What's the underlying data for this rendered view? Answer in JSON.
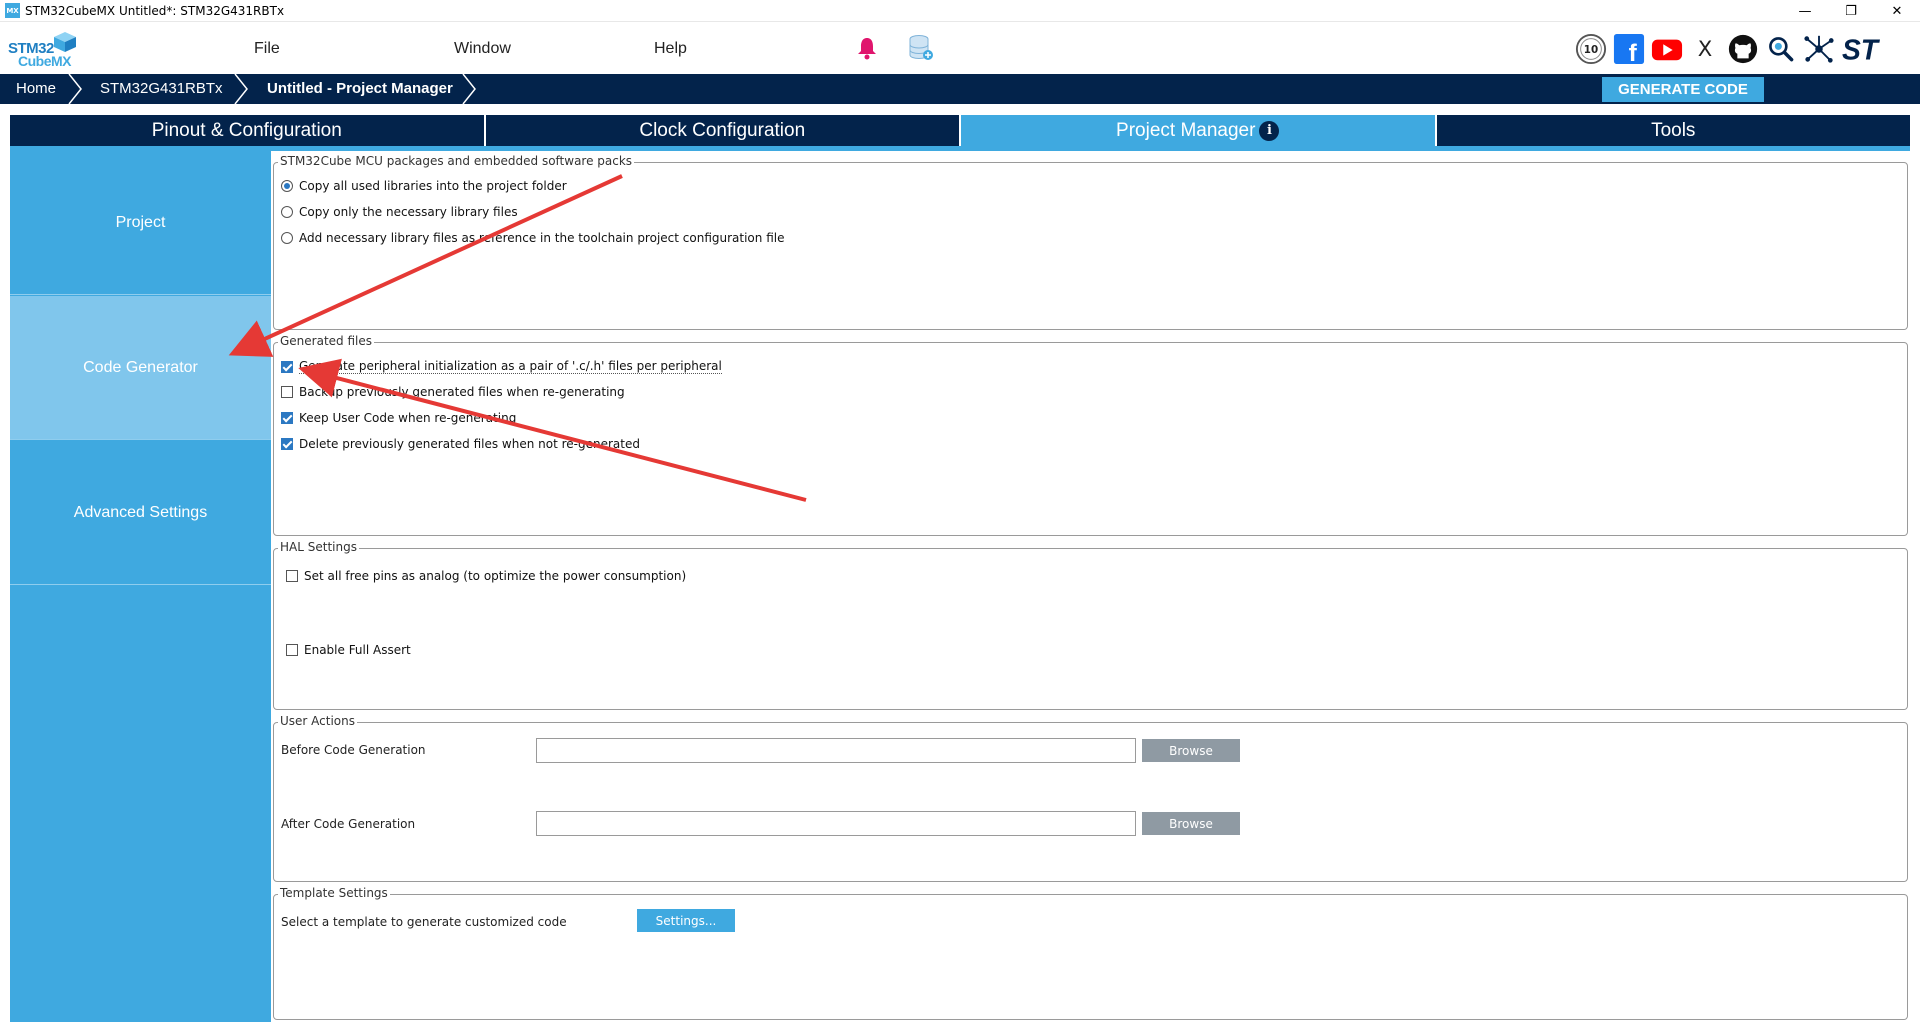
{
  "window": {
    "app_icon_text": "MX",
    "title": "STM32CubeMX Untitled*: STM32G431RBTx",
    "controls": {
      "minimize": "—",
      "restore": "❐",
      "close": "✕"
    }
  },
  "menu": {
    "logo_line1": "STM32",
    "logo_line2": "CubeMX",
    "items": [
      "File",
      "Window",
      "Help"
    ]
  },
  "icons": {
    "bell": "bell-icon",
    "database": "database-icon",
    "social": [
      "anniversary-badge-icon",
      "facebook-icon",
      "youtube-icon",
      "x-icon",
      "github-icon",
      "search-icon",
      "network-icon",
      "st-logo-icon"
    ]
  },
  "social_texts": {
    "badge": "10",
    "facebook": "f",
    "x": "X",
    "st": "ST"
  },
  "colors": {
    "accent": "#3fa9e0",
    "navy": "#03234b",
    "arrow": "#e53935"
  },
  "breadcrumb": [
    "Home",
    "STM32G431RBTx",
    "Untitled - Project Manager"
  ],
  "generate_button": "GENERATE CODE",
  "tabs": [
    {
      "label": "Pinout & Configuration"
    },
    {
      "label": "Clock Configuration"
    },
    {
      "label": "Project Manager",
      "info": "i"
    },
    {
      "label": "Tools"
    }
  ],
  "sidebar": [
    "Project",
    "Code Generator",
    "Advanced Settings"
  ],
  "packages": {
    "legend": "STM32Cube MCU packages and embedded software packs",
    "options": [
      {
        "label": "Copy all used libraries into the project folder",
        "selected": true
      },
      {
        "label": "Copy only the necessary library files",
        "selected": false
      },
      {
        "label": "Add necessary library files as reference in the toolchain project configuration file",
        "selected": false
      }
    ]
  },
  "generated_files": {
    "legend": "Generated files",
    "options": [
      {
        "label": "Generate peripheral initialization as a pair of '.c/.h' files per peripheral",
        "checked": true
      },
      {
        "label": "Backup previously generated files when re-generating",
        "checked": false
      },
      {
        "label": "Keep User Code when re-generating",
        "checked": true
      },
      {
        "label": "Delete previously generated files when not re-generated",
        "checked": true
      }
    ]
  },
  "hal_settings": {
    "legend": "HAL Settings",
    "options": [
      {
        "label": "Set all free pins as analog (to optimize the power consumption)",
        "checked": false
      },
      {
        "label": "Enable Full Assert",
        "checked": false
      }
    ]
  },
  "user_actions": {
    "legend": "User Actions",
    "before_label": "Before Code Generation",
    "before_value": "",
    "after_label": "After Code Generation",
    "after_value": "",
    "browse_label": "Browse"
  },
  "template_settings": {
    "legend": "Template Settings",
    "label": "Select a template to generate customized code",
    "button": "Settings..."
  }
}
